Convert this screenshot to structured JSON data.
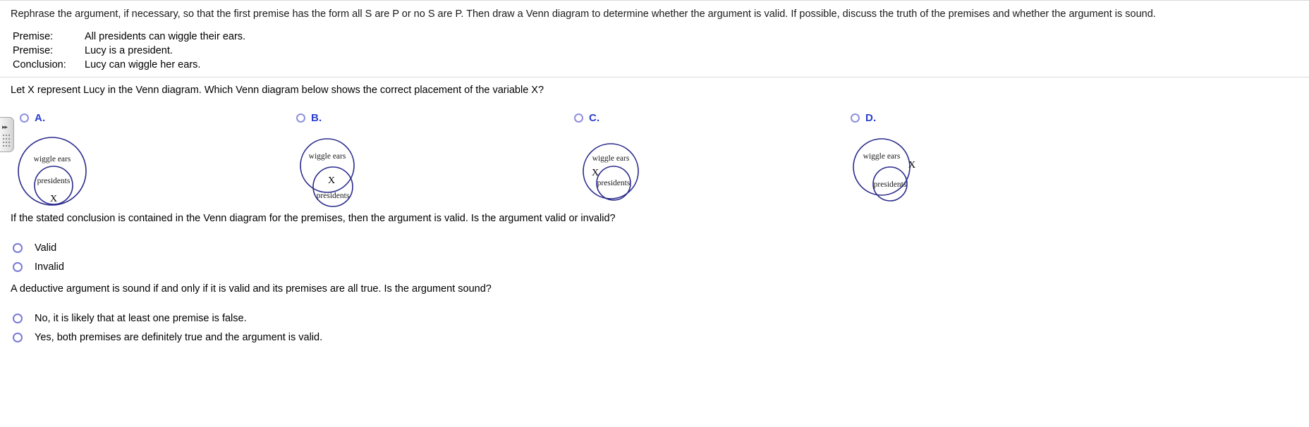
{
  "prompt": "Rephrase the argument, if necessary, so that the first premise has the form all S are P or no S are P. Then draw a Venn diagram to determine whether the argument is valid. If possible, discuss the truth of the premises and whether the argument is sound.",
  "argument": {
    "rows": [
      {
        "label": "Premise:",
        "text": "All presidents can wiggle their ears."
      },
      {
        "label": "Premise:",
        "text": "Lucy is a president."
      },
      {
        "label": "Conclusion:",
        "text": "Lucy can wiggle her ears."
      }
    ]
  },
  "question1": "Let X represent Lucy in the Venn diagram. Which Venn diagram below shows the correct placement of the variable X?",
  "choices": [
    {
      "letter": "A.",
      "outer_label": "wiggle ears",
      "inner_label": "presidents",
      "marker": "X"
    },
    {
      "letter": "B.",
      "outer_label": "wiggle ears",
      "inner_label": "presidents",
      "marker": "X"
    },
    {
      "letter": "C.",
      "outer_label": "wiggle ears",
      "inner_label": "presidents",
      "marker": "X"
    },
    {
      "letter": "D.",
      "outer_label": "wiggle ears",
      "inner_label": "presidents",
      "marker": "X"
    }
  ],
  "question2": "If the stated conclusion is contained in the Venn diagram for the premises, then the argument is valid. Is the argument valid or invalid?",
  "validity_options": [
    {
      "label": "Valid"
    },
    {
      "label": "Invalid"
    }
  ],
  "question3": "A deductive argument is sound if and only if it is valid and its premises are all true. Is the argument sound?",
  "soundness_options": [
    {
      "label": "No, it is likely that at least one premise is false."
    },
    {
      "label": "Yes, both premises are definitely true and the argument is valid."
    }
  ],
  "colors": {
    "venn_stroke": "#2a2a8c",
    "letter_blue": "#2b3fd0",
    "radio_border": "#8f8fe0",
    "rule": "#d9d9dd"
  },
  "drawer": {
    "arrows": "▸▸"
  }
}
